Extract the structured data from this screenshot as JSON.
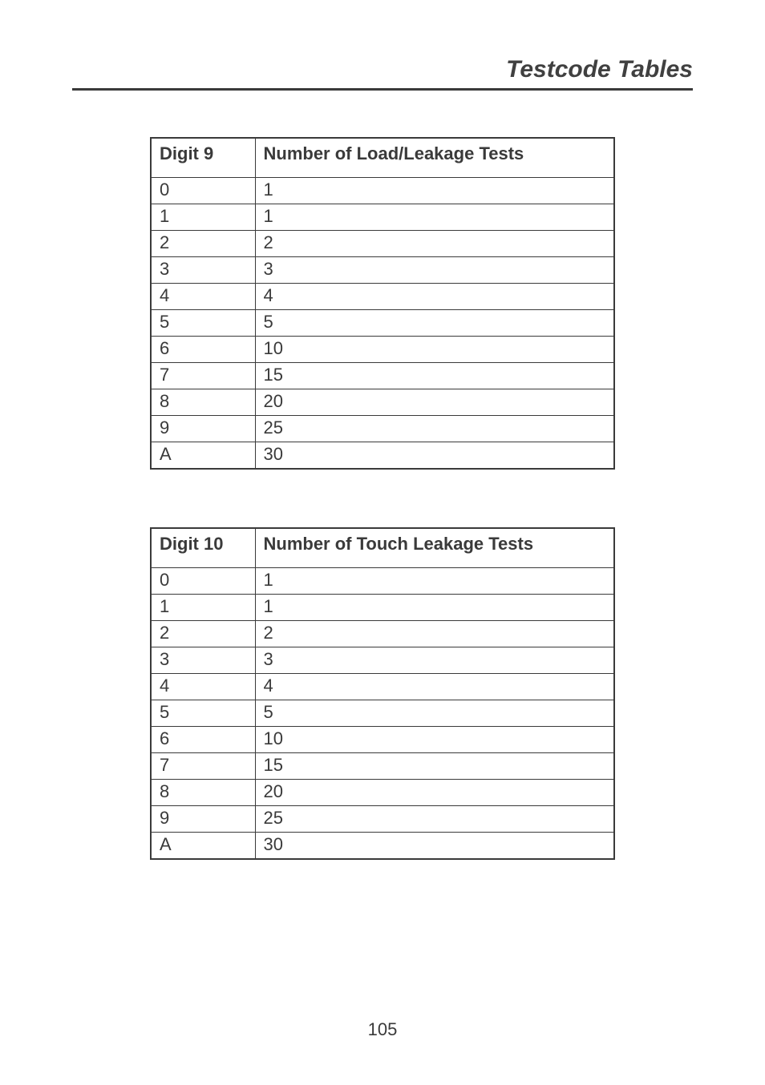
{
  "header": {
    "title": "Testcode Tables"
  },
  "tables": [
    {
      "headers": {
        "digit": "Digit 9",
        "value": "Number of Load/Leakage Tests"
      },
      "rows": [
        {
          "digit": "0",
          "value": "1"
        },
        {
          "digit": "1",
          "value": "1"
        },
        {
          "digit": "2",
          "value": "2"
        },
        {
          "digit": "3",
          "value": "3"
        },
        {
          "digit": "4",
          "value": "4"
        },
        {
          "digit": "5",
          "value": "5"
        },
        {
          "digit": "6",
          "value": "10"
        },
        {
          "digit": "7",
          "value": "15"
        },
        {
          "digit": "8",
          "value": "20"
        },
        {
          "digit": "9",
          "value": "25"
        },
        {
          "digit": "A",
          "value": "30"
        }
      ]
    },
    {
      "headers": {
        "digit": "Digit 10",
        "value": "Number of Touch Leakage Tests"
      },
      "rows": [
        {
          "digit": "0",
          "value": "1"
        },
        {
          "digit": "1",
          "value": "1"
        },
        {
          "digit": "2",
          "value": "2"
        },
        {
          "digit": "3",
          "value": "3"
        },
        {
          "digit": "4",
          "value": "4"
        },
        {
          "digit": "5",
          "value": "5"
        },
        {
          "digit": "6",
          "value": "10"
        },
        {
          "digit": "7",
          "value": "15"
        },
        {
          "digit": "8",
          "value": "20"
        },
        {
          "digit": "9",
          "value": "25"
        },
        {
          "digit": "A",
          "value": "30"
        }
      ]
    }
  ],
  "pageNumber": "105",
  "chart_data": [
    {
      "type": "table",
      "title": "Digit 9 — Number of Load/Leakage Tests",
      "categories": [
        "0",
        "1",
        "2",
        "3",
        "4",
        "5",
        "6",
        "7",
        "8",
        "9",
        "A"
      ],
      "values": [
        1,
        1,
        2,
        3,
        4,
        5,
        10,
        15,
        20,
        25,
        30
      ]
    },
    {
      "type": "table",
      "title": "Digit 10 — Number of Touch Leakage Tests",
      "categories": [
        "0",
        "1",
        "2",
        "3",
        "4",
        "5",
        "6",
        "7",
        "8",
        "9",
        "A"
      ],
      "values": [
        1,
        1,
        2,
        3,
        4,
        5,
        10,
        15,
        20,
        25,
        30
      ]
    }
  ]
}
